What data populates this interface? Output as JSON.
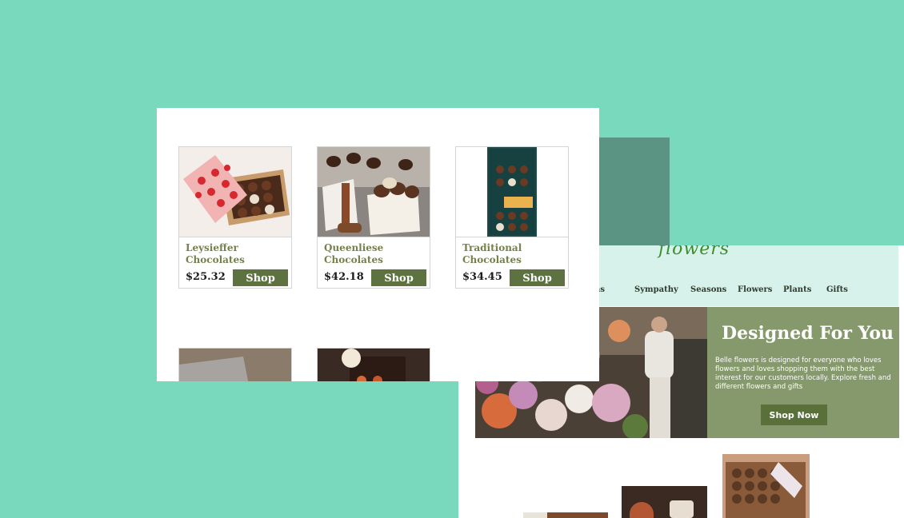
{
  "site": {
    "logo": "flowers",
    "nav": [
      "sions",
      "Sympathy",
      "Seasons",
      "Flowers",
      "Plants",
      "Gifts"
    ],
    "hero": {
      "title": "Designed For You",
      "text": "Belle flowers is designed for everyone who loves flowers and loves shopping them with the best interest for our customers locally. Explore fresh and different flowers and gifts",
      "button": "Shop Now"
    }
  },
  "products": [
    {
      "name": "Leysieffer Chocolates",
      "price": "$25.32",
      "button": "Shop"
    },
    {
      "name": "Queenliese Chocolates",
      "price": "$42.18",
      "button": "Shop"
    },
    {
      "name": "Traditional Chocolates",
      "price": "$34.45",
      "button": "Shop"
    }
  ],
  "colors": {
    "background": "#78d9bd",
    "accent_green": "#5e7140",
    "hero_panel": "#86996c",
    "product_name": "#74814a"
  }
}
